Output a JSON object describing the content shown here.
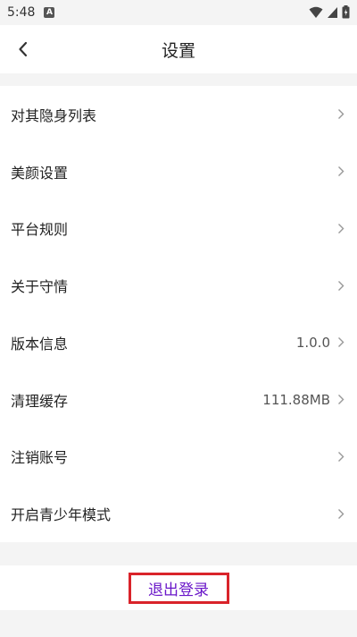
{
  "status_bar": {
    "time": "5:48",
    "notification_glyph": "A"
  },
  "nav": {
    "title": "设置"
  },
  "settings_items": [
    {
      "label": "对其隐身列表",
      "value": ""
    },
    {
      "label": "美颜设置",
      "value": ""
    },
    {
      "label": "平台规则",
      "value": ""
    },
    {
      "label": "关于守情",
      "value": ""
    },
    {
      "label": "版本信息",
      "value": "1.0.0"
    },
    {
      "label": "清理缓存",
      "value": "111.88MB"
    },
    {
      "label": "注销账号",
      "value": ""
    },
    {
      "label": "开启青少年模式",
      "value": ""
    }
  ],
  "logout": {
    "label": "退出登录"
  },
  "colors": {
    "logout_text": "#6a17c9",
    "highlight_border": "#d9232a",
    "background": "#f4f4f4"
  },
  "icons": {
    "back": "back-arrow-icon",
    "chevron": "chevron-right-icon",
    "wifi": "wifi-icon",
    "signal": "signal-icon",
    "battery": "battery-icon"
  }
}
